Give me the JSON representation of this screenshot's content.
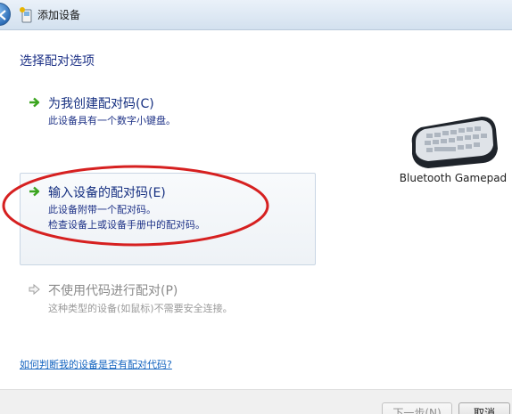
{
  "window": {
    "title": "添加设备"
  },
  "heading": "选择配对选项",
  "options": [
    {
      "title": "为我创建配对码(C)",
      "desc": [
        "此设备具有一个数字小键盘。"
      ],
      "enabled": true
    },
    {
      "title": "输入设备的配对码(E)",
      "desc": [
        "此设备附带一个配对码。",
        "检查设备上或设备手册中的配对码。"
      ],
      "enabled": true,
      "highlighted": true
    },
    {
      "title": "不使用代码进行配对(P)",
      "desc": [
        "这种类型的设备(如鼠标)不需要安全连接。"
      ],
      "enabled": false
    }
  ],
  "device": {
    "name": "Bluetooth Gamepad",
    "icon": "keyboard-device-icon"
  },
  "help_link": "如何判断我的设备是否有配对代码?",
  "buttons": {
    "next": "下一步(N)",
    "cancel": "取消"
  },
  "colors": {
    "accent_arrow": "#3ba51f",
    "link": "#1565c0",
    "annotation_circle": "#d62020"
  }
}
